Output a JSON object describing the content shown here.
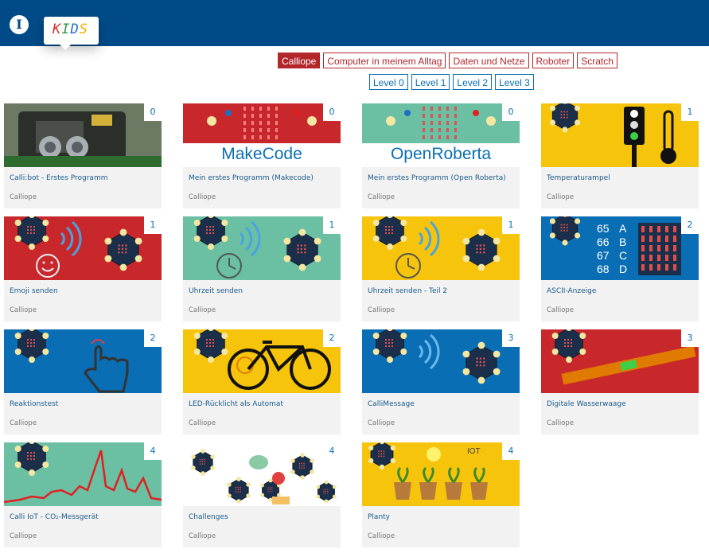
{
  "header": {
    "info_label": "I",
    "kids_letters": [
      {
        "ch": "K",
        "color": "#d6322b"
      },
      {
        "ch": "I",
        "color": "#2a9a47"
      },
      {
        "ch": "D",
        "color": "#1d6fc4"
      },
      {
        "ch": "S",
        "color": "#f4b400"
      }
    ]
  },
  "filters": {
    "categories": [
      {
        "label": "Calliope",
        "active": true
      },
      {
        "label": "Computer in meinem Alltag",
        "active": false
      },
      {
        "label": "Daten und Netze",
        "active": false
      },
      {
        "label": "Roboter",
        "active": false
      },
      {
        "label": "Scratch",
        "active": false
      }
    ],
    "levels": [
      {
        "label": "Level 0"
      },
      {
        "label": "Level 1"
      },
      {
        "label": "Level 2"
      },
      {
        "label": "Level 3"
      }
    ]
  },
  "cards": [
    {
      "title": "Calli:bot - Erstes Programm",
      "category": "Calliope",
      "level": "0",
      "bg": "#556b4f",
      "art": "photo"
    },
    {
      "title": "Mein erstes Programm (Makecode)",
      "category": "Calliope",
      "level": "0",
      "bg": "#c8282c",
      "art": "makecode",
      "banner": "MakeCode"
    },
    {
      "title": "Mein erstes Programm (Open Roberta)",
      "category": "Calliope",
      "level": "0",
      "bg": "#6bbfa3",
      "art": "makecode",
      "banner": "OpenRoberta"
    },
    {
      "title": "Temperaturampel",
      "category": "Calliope",
      "level": "1",
      "bg": "#f6c40a",
      "art": "traffic"
    },
    {
      "title": "Emoji senden",
      "category": "Calliope",
      "level": "1",
      "bg": "#c8282c",
      "art": "radio-smile"
    },
    {
      "title": "Uhrzeit senden",
      "category": "Calliope",
      "level": "1",
      "bg": "#6bbfa3",
      "art": "radio-clock"
    },
    {
      "title": "Uhrzeit senden - Teil 2",
      "category": "Calliope",
      "level": "1",
      "bg": "#f6c40a",
      "art": "radio-clock"
    },
    {
      "title": "ASCII-Anzeige",
      "category": "Calliope",
      "level": "2",
      "bg": "#0a6eb4",
      "art": "ascii",
      "ascii": [
        {
          "num": "65",
          "ch": "A"
        },
        {
          "num": "66",
          "ch": "B"
        },
        {
          "num": "67",
          "ch": "C"
        },
        {
          "num": "68",
          "ch": "D"
        }
      ]
    },
    {
      "title": "Reaktionstest",
      "category": "Calliope",
      "level": "2",
      "bg": "#0a6eb4",
      "art": "hand"
    },
    {
      "title": "LED-Rücklicht als Automat",
      "category": "Calliope",
      "level": "2",
      "bg": "#f6c40a",
      "art": "bike"
    },
    {
      "title": "CalliMessage",
      "category": "Calliope",
      "level": "3",
      "bg": "#0a6eb4",
      "art": "radio"
    },
    {
      "title": "Digitale Wasserwaage",
      "category": "Calliope",
      "level": "3",
      "bg": "#c8282c",
      "art": "level"
    },
    {
      "title": "Calli IoT - CO₂-Messgerät",
      "category": "Calliope",
      "level": "4",
      "bg": "#6bbfa3",
      "art": "chart"
    },
    {
      "title": "Challenges",
      "category": "Calliope",
      "level": "4",
      "bg": "#ffffff",
      "art": "challenges"
    },
    {
      "title": "Planty",
      "category": "Calliope",
      "level": "4",
      "bg": "#f6c40a",
      "art": "planty",
      "tag": "IOT"
    }
  ]
}
